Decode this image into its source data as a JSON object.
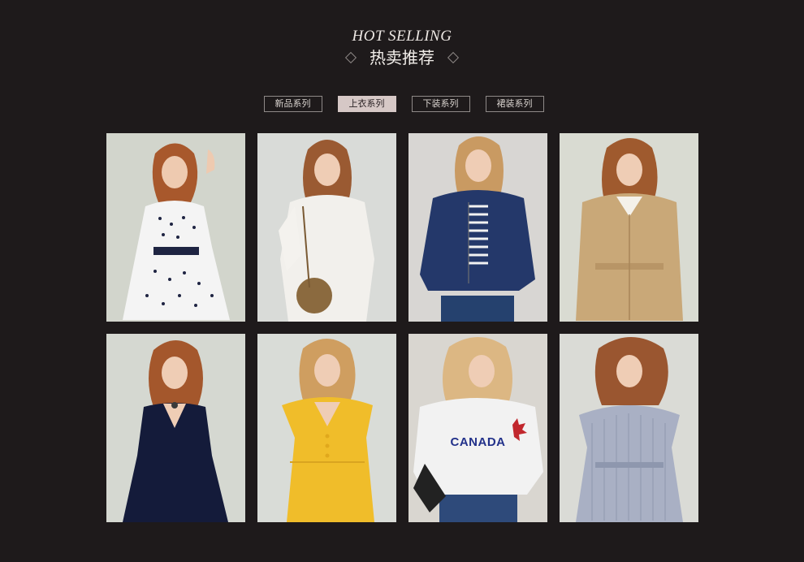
{
  "header": {
    "eyebrow": "HOT SELLING",
    "title": "热卖推荐"
  },
  "tabs": [
    {
      "label": "新品系列",
      "active": false
    },
    {
      "label": "上衣系列",
      "active": true
    },
    {
      "label": "下装系列",
      "active": false
    },
    {
      "label": "裙装系列",
      "active": false
    }
  ],
  "products": [
    {
      "garment": "white polka-dot dress",
      "bg": "#d2d5cc"
    },
    {
      "garment": "white lace top",
      "bg": "#d9dbd8"
    },
    {
      "garment": "denim jacket",
      "bg": "#d8d6d3"
    },
    {
      "garment": "beige trench coat",
      "bg": "#d9dbd2"
    },
    {
      "garment": "navy v-neck dress",
      "bg": "#d5d8d1"
    },
    {
      "garment": "yellow dress",
      "bg": "#d9dcd7"
    },
    {
      "garment": "white sweatshirt",
      "bg": "#d9d6d0",
      "print": "CANADA"
    },
    {
      "garment": "striped shirt dress",
      "bg": "#dadbd6"
    }
  ]
}
